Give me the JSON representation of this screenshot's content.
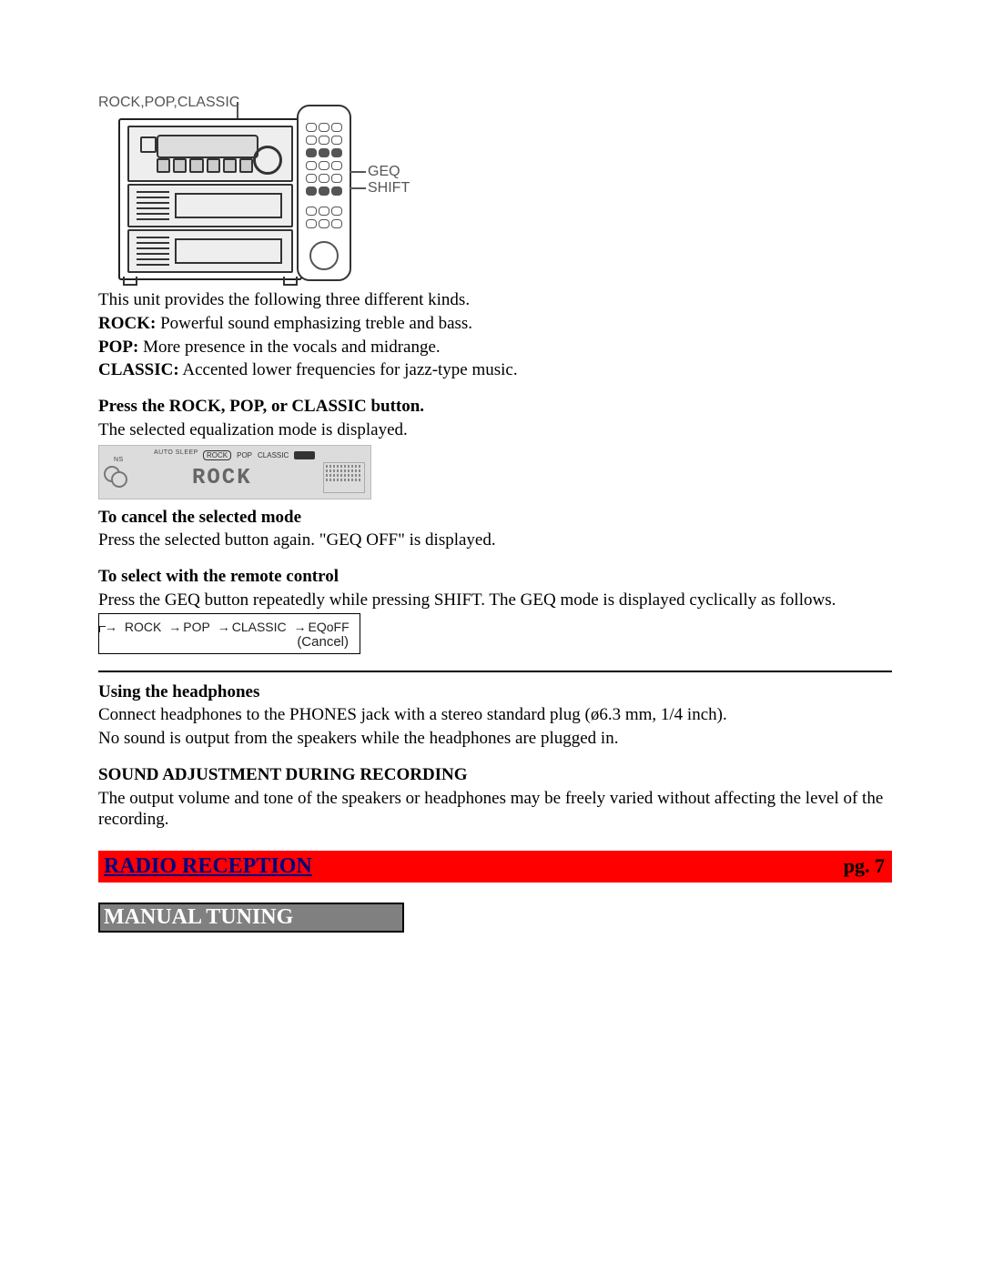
{
  "diagram1": {
    "topLabel": "ROCK,POP,CLASSIC",
    "geqLabel": "GEQ",
    "shiftLabel": "SHIFT"
  },
  "intro": {
    "line1": "This unit provides the following three different kinds.",
    "rockLabel": "ROCK:",
    "rockText": " Powerful sound emphasizing treble and bass.",
    "popLabel": "POP:",
    "popText": " More presence in the vocals and midrange.",
    "classicLabel": "CLASSIC:",
    "classicText": " Accented lower frequencies for jazz-type music."
  },
  "press": {
    "heading": "Press the ROCK, POP, or CLASSIC button.",
    "text": "The selected equalization mode is displayed."
  },
  "displayImg": {
    "tiny1": "AUTO   SLEEP",
    "tiny2": "NS",
    "tagRock": "ROCK",
    "tagPop": "POP",
    "tagClassic": "CLASSIC",
    "big": "ROCK"
  },
  "cancel": {
    "heading": "To cancel the selected mode",
    "text": "Press the selected button again.  \"GEQ OFF\" is displayed."
  },
  "remoteSel": {
    "heading": "To select with the remote control",
    "text": "Press the GEQ button repeatedly while pressing SHIFT.  The GEQ mode is displayed cyclically as follows."
  },
  "cycle": {
    "rock": "ROCK",
    "pop": "POP",
    "classic": "CLASSIC",
    "eqoff": "EQoFF",
    "cancel": "(Cancel)"
  },
  "headphones": {
    "heading": "Using the headphones",
    "line1": "Connect headphones to the PHONES jack with a stereo standard plug (ø6.3 mm, 1/4 inch).",
    "line2": "No sound is output from the speakers while the headphones are plugged in."
  },
  "soundAdj": {
    "heading": "SOUND ADJUSTMENT DURING RECORDING",
    "text": "The output volume and tone of the speakers or headphones may be freely varied without affecting the level of the recording."
  },
  "chapter": {
    "title": "RADIO RECEPTION",
    "page": "pg. 7"
  },
  "sub": {
    "title": "MANUAL TUNING"
  }
}
